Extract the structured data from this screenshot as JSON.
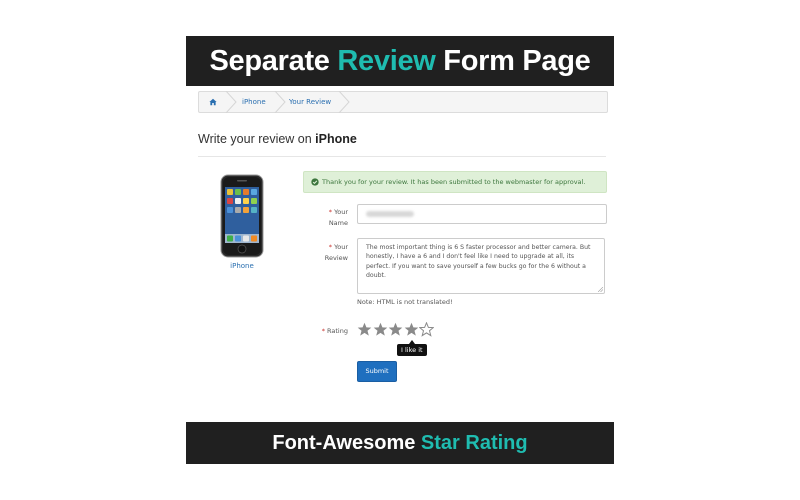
{
  "banner_top": {
    "part1": "Separate ",
    "highlight": "Review",
    "part2": " Form Page"
  },
  "banner_bottom": {
    "part1": "Font-Awesome ",
    "highlight": "Star Rating"
  },
  "breadcrumb": {
    "items": [
      "iPhone",
      "Your Review"
    ]
  },
  "heading": {
    "prefix": "Write your review on ",
    "product": "iPhone"
  },
  "product": {
    "caption": "iPhone"
  },
  "alert": {
    "text": "Thank you for your review. It has been submitted to the webmaster for approval."
  },
  "form": {
    "name_label_1": "Your",
    "name_label_2": "Name",
    "review_label_1": "Your",
    "review_label_2": "Review",
    "review_text": "The most important thing is 6 S faster processor and better camera. But honestly, I have a 6 and I don't feel like I need to upgrade at all, its perfect. If you want to save yourself a few bucks go for the 6 without a doubt.",
    "note": "Note: HTML is not translated!",
    "rating_label": "Rating",
    "rating_value": 4,
    "rating_max": 5,
    "tooltip": "I like it",
    "submit_label": "Submit"
  },
  "colors": {
    "accent": "#1fbcb0",
    "link": "#2a6fb0",
    "button": "#1f6fbf",
    "success_bg": "#dff0d8",
    "star": "#8a8a8a"
  }
}
